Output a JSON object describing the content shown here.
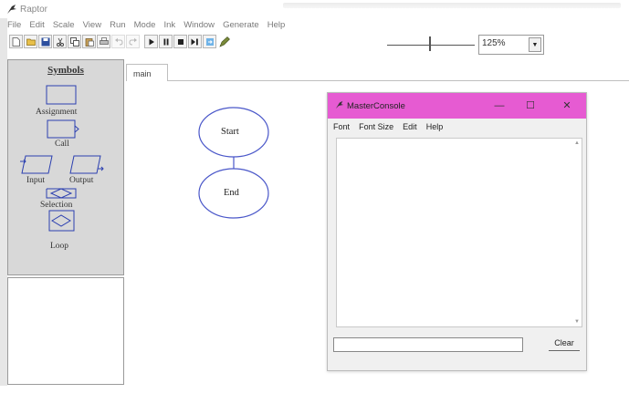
{
  "app": {
    "title": "Raptor"
  },
  "menubar": {
    "items": [
      "File",
      "Edit",
      "Scale",
      "View",
      "Run",
      "Mode",
      "Ink",
      "Window",
      "Generate",
      "Help"
    ]
  },
  "toolbar": {
    "zoom_value": "125%",
    "zoom_slider_fraction": 0.48
  },
  "symbols": {
    "title": "Symbols",
    "items": [
      "Assignment",
      "Call",
      "Input",
      "Output",
      "Selection",
      "Loop"
    ]
  },
  "tabs": [
    "main"
  ],
  "flowchart": {
    "nodes": [
      "Start",
      "End"
    ],
    "edge_color": "#4a57c9"
  },
  "console": {
    "title": "MasterConsole",
    "menu": [
      "Font",
      "Font Size",
      "Edit",
      "Help"
    ],
    "clear_label": "Clear",
    "title_color": "#e65bd2",
    "window_buttons": [
      "—",
      "☐",
      "✕"
    ]
  }
}
